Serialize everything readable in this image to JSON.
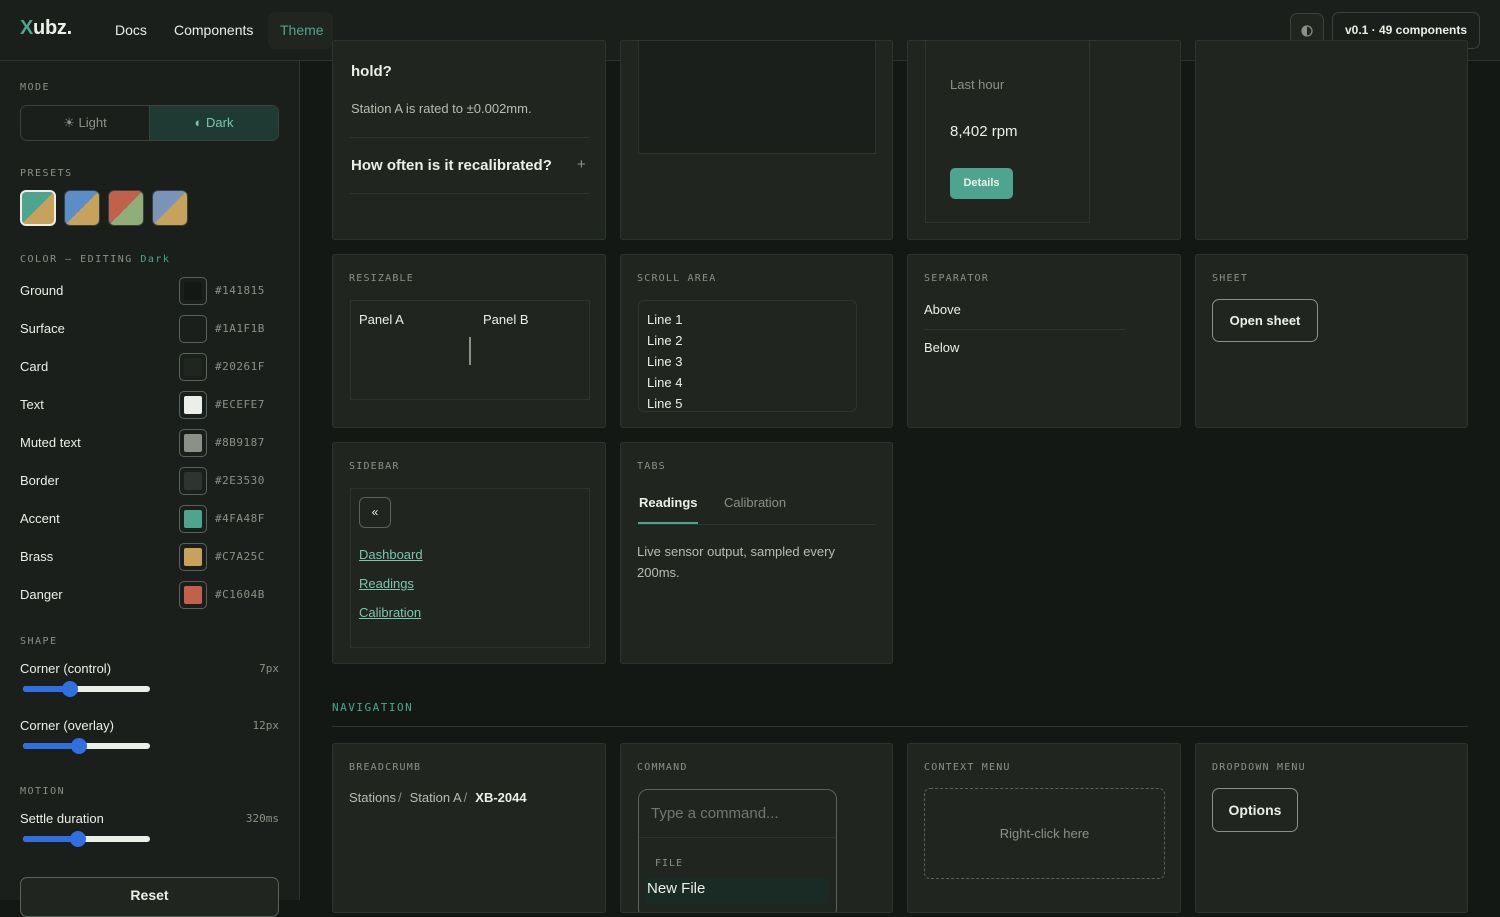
{
  "header": {
    "logo_x": "X",
    "logo_rest": "ubz.",
    "nav": [
      "Docs",
      "Components",
      "Theme"
    ],
    "active_nav": "Theme",
    "theme_icon": "half-circle-icon",
    "version": "v0.1 · 49 components"
  },
  "sidebar": {
    "mode_label": "MODE",
    "mode_light": "☀ Light",
    "mode_dark": "◐ Dark",
    "mode_selected": "Dark",
    "presets_label": "PRESETS",
    "presets": [
      {
        "a": "#4FA48F",
        "b": "#C7A25C"
      },
      {
        "a": "#5B8EC9",
        "b": "#C7A25C"
      },
      {
        "a": "#C1604B",
        "b": "#8FAE78"
      },
      {
        "a": "#7A93B8",
        "b": "#C7A25C"
      }
    ],
    "color_label": "COLOR — EDITING",
    "color_editing": "Dark",
    "colors": [
      {
        "label": "Ground",
        "hex": "#141815"
      },
      {
        "label": "Surface",
        "hex": "#1A1F1B"
      },
      {
        "label": "Card",
        "hex": "#20261F"
      },
      {
        "label": "Text",
        "hex": "#ECEFE7"
      },
      {
        "label": "Muted text",
        "hex": "#8B9187"
      },
      {
        "label": "Border",
        "hex": "#2E3530"
      },
      {
        "label": "Accent",
        "hex": "#4FA48F"
      },
      {
        "label": "Brass",
        "hex": "#C7A25C"
      },
      {
        "label": "Danger",
        "hex": "#C1604B"
      }
    ],
    "shape_label": "SHAPE",
    "corner_control_label": "Corner (control)",
    "corner_control_value": "7px",
    "corner_control_fraction": 0.37,
    "corner_overlay_label": "Corner (overlay)",
    "corner_overlay_value": "12px",
    "corner_overlay_fraction": 0.44,
    "motion_label": "MOTION",
    "settle_label": "Settle duration",
    "settle_value": "320ms",
    "settle_fraction": 0.43,
    "reset": "Reset"
  },
  "accordion": {
    "q1_tail": "hold?",
    "a1": "Station A is rated to ±0.002mm.",
    "q2": "How often is it recalibrated?",
    "q2_icon": "+"
  },
  "stat_card": {
    "sub": "Last hour",
    "value": "8,402 rpm",
    "button": "Details"
  },
  "resizable": {
    "title": "RESIZABLE",
    "panel_a": "Panel A",
    "panel_b": "Panel B"
  },
  "scroll_area": {
    "title": "SCROLL AREA",
    "lines": [
      "Line 1",
      "Line 2",
      "Line 3",
      "Line 4",
      "Line 5"
    ]
  },
  "separator": {
    "title": "SEPARATOR",
    "above": "Above",
    "below": "Below"
  },
  "sheet": {
    "title": "SHEET",
    "button": "Open sheet"
  },
  "sidebar_demo": {
    "title": "SIDEBAR",
    "collapse": "«",
    "links": [
      "Dashboard",
      "Readings",
      "Calibration"
    ]
  },
  "tabs_demo": {
    "title": "TABS",
    "tabs": [
      "Readings",
      "Calibration"
    ],
    "active": "Readings",
    "content": "Live sensor output, sampled every 200ms."
  },
  "navigation_section": "NAVIGATION",
  "breadcrumb": {
    "title": "BREADCRUMB",
    "items": [
      "Stations",
      "Station A",
      "XB-2044"
    ],
    "sep": "/"
  },
  "command": {
    "title": "COMMAND",
    "placeholder": "Type a command...",
    "group": "FILE",
    "item": "New File"
  },
  "context_menu": {
    "title": "CONTEXT MENU",
    "hint": "Right-click here"
  },
  "dropdown_menu": {
    "title": "DROPDOWN MENU",
    "button": "Options"
  }
}
